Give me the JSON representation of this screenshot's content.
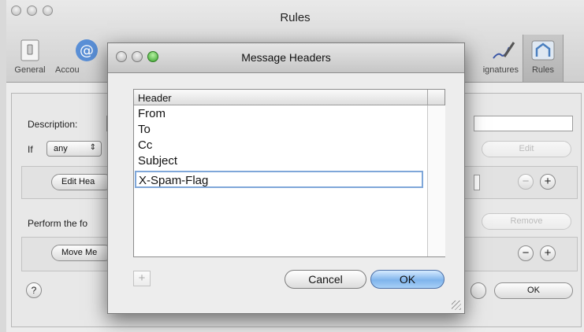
{
  "rules_window": {
    "title": "Rules",
    "toolbar": [
      {
        "label": "General",
        "icon": "switch-icon"
      },
      {
        "label": "Accou",
        "icon": "at-sign-icon"
      },
      {
        "label": "ignatures",
        "icon": "signature-pen-icon"
      },
      {
        "label": "Rules",
        "icon": "rules-icon"
      }
    ],
    "description_label": "Description:",
    "if_label": "If",
    "if_popup": "any",
    "edit_headers_button": "Edit Hea",
    "perform_label": "Perform the fo",
    "move_message_button": "Move Me",
    "edit_button": "Edit",
    "remove_button": "Remove",
    "ok_button": "OK",
    "help_label": "?"
  },
  "message_headers_sheet": {
    "title": "Message Headers",
    "column_header": "Header",
    "headers": [
      "From",
      "To",
      "Cc",
      "Subject"
    ],
    "editing_value": "X-Spam-Flag",
    "add_label": "+",
    "cancel_button": "Cancel",
    "ok_button": "OK"
  },
  "colors": {
    "ok_button_fill": "#7fb4ec",
    "edit_focus_ring": "#7fa7d9",
    "zoom_light": "#36a12a"
  }
}
